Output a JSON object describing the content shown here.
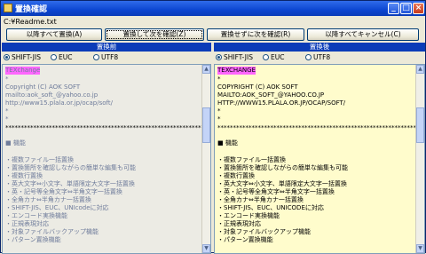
{
  "window": {
    "title": "置換確認",
    "controls": {
      "minimize": "_",
      "maximize": "□",
      "close": "×"
    }
  },
  "file_path": "C:¥Readme.txt",
  "toolbar": {
    "replace_all": "以降すべて置換(A)",
    "replace_next": "置換して次を確認(Z)",
    "skip_next": "置換せずに次を確認(R)",
    "cancel_all": "以降すべてキャンセル(C)"
  },
  "left_pane": {
    "header": "置換前",
    "encodings": [
      "SHIFT-JIS",
      "EUC",
      "UTF8"
    ],
    "selected_encoding": "SHIFT-JIS",
    "lines": [
      {
        "text": "TEXchange",
        "color": "#6f7c9b"
      },
      {
        "text": "*",
        "color": "#6f7c9b"
      },
      {
        "text": "Copyright (C) AOK SOFT",
        "color": "#6f7c9b"
      },
      {
        "text": "mailto:aok_soft_@yahoo.co.jp",
        "color": "#6f7c9b"
      },
      {
        "text": "http://www15.plala.or.jp/ocap/soft/",
        "color": "#6f7c9b"
      },
      {
        "text": "*",
        "color": "#6f7c9b"
      },
      {
        "text": "*",
        "color": "#6f7c9b"
      },
      {
        "text": "*************************************************************************",
        "color": "#000000"
      },
      {
        "text": "",
        "color": "#000000"
      },
      {
        "text": "■ 機能",
        "color": "#6f7c9b"
      },
      {
        "text": "",
        "color": "#000000"
      },
      {
        "text": "・複数ファイル一括置換",
        "color": "#6f7c9b"
      },
      {
        "text": "・置換箇所を確認しながらの簡単な編集も可能",
        "color": "#6f7c9b"
      },
      {
        "text": "・複数行置換",
        "color": "#6f7c9b"
      },
      {
        "text": "・英大文字⇔小文字、単語限定大文字一括置換",
        "color": "#6f7c9b"
      },
      {
        "text": "・英・記号等全角文字⇔半角文字一括置換",
        "color": "#6f7c9b"
      },
      {
        "text": "・全角カナ⇔半角カナ一括置換",
        "color": "#6f7c9b"
      },
      {
        "text": "・SHIFT-JIS、EUC、UNIcodeに対応",
        "color": "#6f7c9b"
      },
      {
        "text": "・エンコード実換機能",
        "color": "#6f7c9b"
      },
      {
        "text": "・正規表現対応",
        "color": "#6f7c9b"
      },
      {
        "text": "・対象ファイルバックアップ機能",
        "color": "#6f7c9b"
      },
      {
        "text": "・パターン置換機能",
        "color": "#6f7c9b"
      }
    ]
  },
  "right_pane": {
    "header": "置換後",
    "encodings": [
      "SHIFT-JIS",
      "EUC",
      "UTF8"
    ],
    "selected_encoding": "SHIFT-JIS",
    "lines": [
      {
        "text": "TEXCHANGE",
        "color": "#000000"
      },
      {
        "text": "*",
        "color": "#000000"
      },
      {
        "text": "COPYRIGHT (C) AOK SOFT",
        "color": "#000000"
      },
      {
        "text": "MAILTO:AOK_SOFT_@YAHOO.CO.JP",
        "color": "#000000"
      },
      {
        "text": "HTTP://WWW15.PLALA.OR.JP/OCAP/SOFT/",
        "color": "#000000"
      },
      {
        "text": "*",
        "color": "#000000"
      },
      {
        "text": "*",
        "color": "#000000"
      },
      {
        "text": "*************************************************************************",
        "color": "#000000"
      },
      {
        "text": "",
        "color": "#000000"
      },
      {
        "text": "■ 機能",
        "color": "#000000"
      },
      {
        "text": "",
        "color": "#000000"
      },
      {
        "text": "・複数ファイル一括置換",
        "color": "#000000"
      },
      {
        "text": "・置換箇所を確認しながらの簡単な編集も可能",
        "color": "#000000"
      },
      {
        "text": "・複数行置換",
        "color": "#000000"
      },
      {
        "text": "・英大文字⇔小文字、単語限定大文字一括置換",
        "color": "#000000"
      },
      {
        "text": "・英・記号等全角文字⇔半角文字一括置換",
        "color": "#000000"
      },
      {
        "text": "・全角カナ⇔半角カナ一括置換",
        "color": "#000000"
      },
      {
        "text": "・SHIFT-JIS、EUC、UNICODEに対応",
        "color": "#000000"
      },
      {
        "text": "・エンコード実換機能",
        "color": "#000000"
      },
      {
        "text": "・正規表現対応",
        "color": "#000000"
      },
      {
        "text": "・対象ファイルバックアップ機能",
        "color": "#000000"
      },
      {
        "text": "・パターン置換機能",
        "color": "#000000"
      }
    ]
  },
  "colors": {
    "title_bar": "#0c46d1",
    "pane_header": "#0a3cb8",
    "left_editor_bg": "#ecebe4",
    "right_editor_bg": "#fffccc",
    "highlight": "#ff66ff",
    "selection": "#3a6fd8"
  }
}
